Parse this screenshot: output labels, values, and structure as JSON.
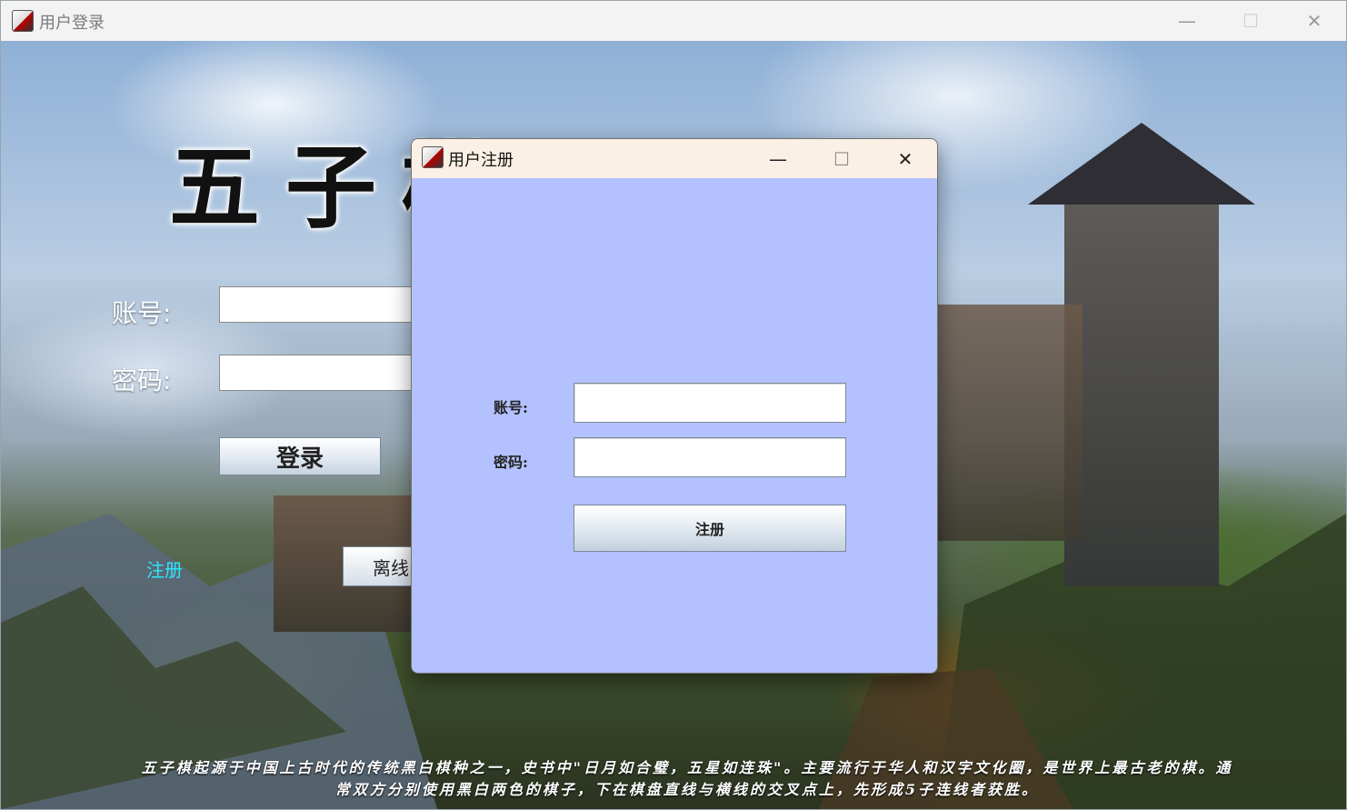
{
  "main_window": {
    "title": "用户登录",
    "controls": {
      "minimize": "—",
      "maximize": "☐",
      "close": "✕"
    },
    "game_title": "五子棋",
    "account_label": "账号:",
    "password_label": "密码:",
    "account_value": "",
    "password_value": "",
    "login_button": "登录",
    "register_link": "注册",
    "offline_button": "离线",
    "intro_text": "五子棋起源于中国上古时代的传统黑白棋种之一，史书中\"日月如合璧，五星如连珠\"。主要流行于华人和汉字文化圈，是世界上最古老的棋。通常双方分别使用黑白两色的棋子，下在棋盘直线与横线的交叉点上，先形成5子连线者获胜。",
    "link_color": "#2ee6ff"
  },
  "dialog": {
    "title": "用户注册",
    "controls": {
      "minimize": "—",
      "maximize": "☐",
      "close": "✕"
    },
    "account_label": "账号:",
    "password_label": "密码:",
    "account_value": "",
    "password_value": "",
    "register_button": "注册",
    "background_color": "#b3c1ff",
    "titlebar_color": "#fbf0e6"
  }
}
